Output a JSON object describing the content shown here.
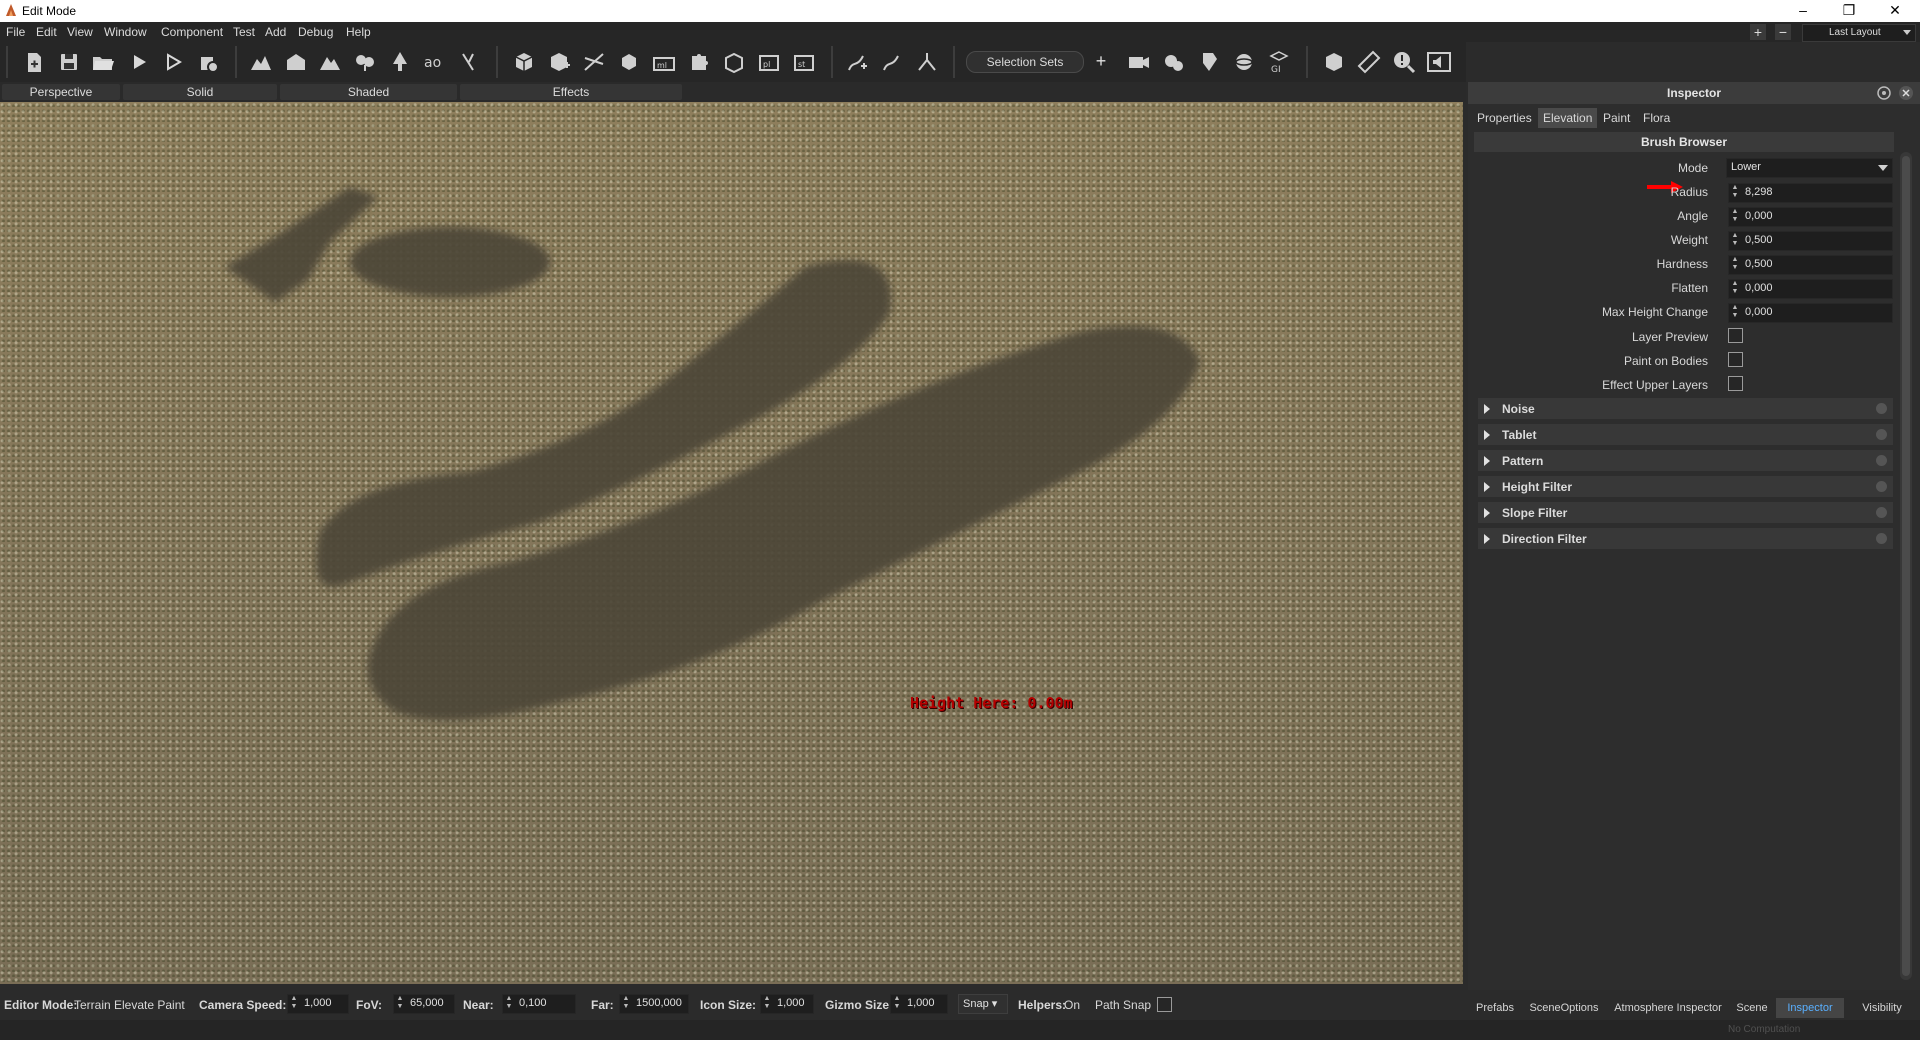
{
  "window": {
    "title": "Edit Mode"
  },
  "menu": [
    "File",
    "Edit",
    "View",
    "Window",
    "Component",
    "Test",
    "Add",
    "Debug",
    "Help"
  ],
  "layout": {
    "plus": "+",
    "minus": "−",
    "current": "Last Layout"
  },
  "toolbar": {
    "selection_sets": "Selection Sets",
    "add_label": "+"
  },
  "view_tabs": [
    "Perspective",
    "Solid",
    "Shaded",
    "Effects"
  ],
  "viewport": {
    "height_readout": "Height Here: 0.00m"
  },
  "inspector": {
    "title": "Inspector",
    "tabs": [
      "Properties",
      "Elevation",
      "Paint",
      "Flora"
    ],
    "active_tab": "Elevation",
    "brush_browser": "Brush Browser",
    "mode": {
      "label": "Mode",
      "value": "Lower"
    },
    "fields": [
      {
        "label": "Radius",
        "value": "8,298"
      },
      {
        "label": "Angle",
        "value": "0,000"
      },
      {
        "label": "Weight",
        "value": "0,500"
      },
      {
        "label": "Hardness",
        "value": "0,500"
      },
      {
        "label": "Flatten",
        "value": "0,000"
      },
      {
        "label": "Max Height Change",
        "value": "0,000"
      }
    ],
    "checkboxes": [
      {
        "label": "Layer Preview",
        "checked": false
      },
      {
        "label": "Paint on Bodies",
        "checked": false
      },
      {
        "label": "Effect Upper Layers",
        "checked": false
      }
    ],
    "sections": [
      "Noise",
      "Tablet",
      "Pattern",
      "Height Filter",
      "Slope Filter",
      "Direction Filter"
    ]
  },
  "status": {
    "editor_mode_label": "Editor Mode:",
    "editor_mode_value": "Terrain Elevate Paint",
    "camera_speed_label": "Camera Speed:",
    "camera_speed": "1,000",
    "fov_label": "FoV:",
    "fov": "65,000",
    "near_label": "Near:",
    "near": "0,100",
    "far_label": "Far:",
    "far": "1500,000",
    "icon_size_label": "Icon Size:",
    "icon_size": "1,000",
    "gizmo_size_label": "Gizmo Size",
    "gizmo_size": "1,000",
    "snap": "Snap",
    "helpers_label": "Helpers:",
    "helpers_value": "On",
    "path_snap_label": "Path Snap"
  },
  "bottom_tabs": [
    "Prefabs",
    "SceneOptions",
    "Atmosphere Inspector",
    "Scene",
    "Inspector",
    "Visibility"
  ],
  "bottom_tabs_active": "Inspector",
  "footer": {
    "computation": "No Computation"
  },
  "colors": {
    "accent_active_tab": "#5ab0ff",
    "height_readout": "#b40000",
    "annotation_arrow": "#ff0000"
  }
}
